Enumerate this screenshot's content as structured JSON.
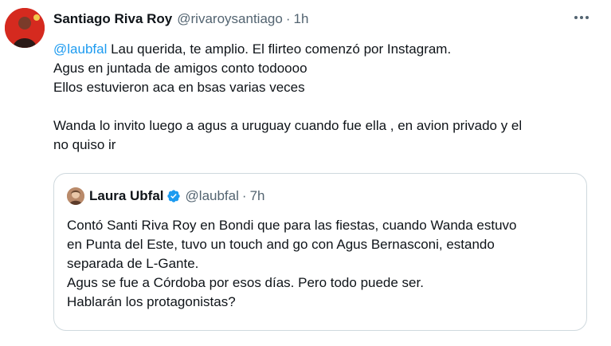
{
  "tweet": {
    "author_name": "Santiago Riva Roy",
    "author_handle": "@rivaroysantiago",
    "separator": "·",
    "time": "1h",
    "mention": "@laubfal",
    "line1_rest": " Lau querida, te amplio. El flirteo comenzó por Instagram.",
    "line2": "Agus en juntada de amigos conto todoooo",
    "line3": "Ellos estuvieron aca en bsas varias veces",
    "line4": "Wanda lo invito luego a agus a uruguay cuando fue ella , en avion privado y el",
    "line5": "no quiso ir"
  },
  "quoted_tweet": {
    "author_name": "Laura Ubfal",
    "author_handle": "@laubfal",
    "separator": "·",
    "time": "7h",
    "lines": [
      "Contó Santi Riva Roy en Bondi que para las fiestas, cuando Wanda estuvo",
      "en Punta del Este, tuvo un touch and go con Agus Bernasconi, estando",
      "separada de L-Gante.",
      "Agus se fue a Córdoba por esos días. Pero todo puede ser.",
      "Hablarán los protagonistas?"
    ]
  },
  "icons": {
    "more": "more-horizontal-icon",
    "verified": "verified-badge-icon"
  },
  "colors": {
    "link": "#1d9bf0",
    "secondary": "#536471",
    "text": "#0f1419",
    "border": "#cfd9de",
    "avatar_bg": "#d52a1f"
  }
}
